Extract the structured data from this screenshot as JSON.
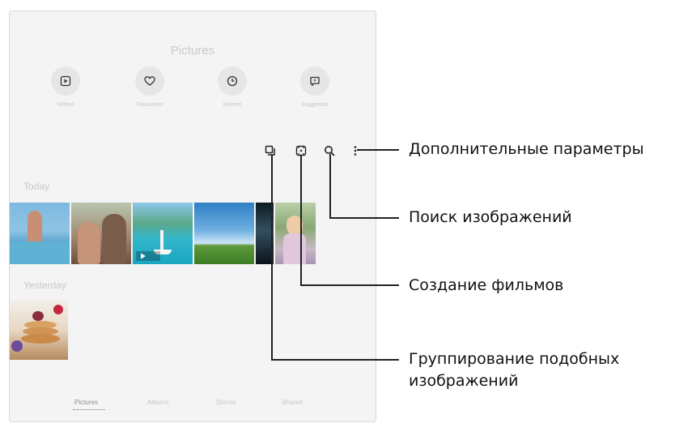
{
  "app": {
    "title": "Pictures"
  },
  "quick_actions": [
    {
      "label": "Videos",
      "icon": "play-icon"
    },
    {
      "label": "Favourites",
      "icon": "heart-icon"
    },
    {
      "label": "Recent",
      "icon": "clock-icon"
    },
    {
      "label": "Suggested",
      "icon": "suggested-icon"
    }
  ],
  "toolbar": {
    "icons": [
      "group-similar-icon",
      "create-movie-icon",
      "search-icon",
      "more-options-icon"
    ]
  },
  "sections": {
    "today": "Today",
    "yesterday": "Yesterday"
  },
  "bottom_nav": [
    "Pictures",
    "Albums",
    "Stories",
    "Shared"
  ],
  "callouts": {
    "more_options": "Дополнительные параметры",
    "search": "Поиск изображений",
    "create_movie": "Создание фильмов",
    "group_similar": "Группирование подобных изображений"
  }
}
